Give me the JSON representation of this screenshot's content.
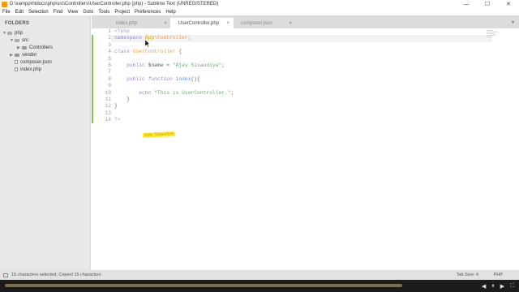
{
  "window": {
    "title": "D:\\xampp\\htdocs\\php\\src\\Controllers\\UserController.php (php) - Sublime Text (UNREGISTERED)",
    "controls": [
      "—",
      "☐",
      "✕"
    ]
  },
  "menu": [
    "File",
    "Edit",
    "Selection",
    "Find",
    "View",
    "Goto",
    "Tools",
    "Project",
    "Preferences",
    "Help"
  ],
  "sidebar": {
    "title": "FOLDERS",
    "items": [
      {
        "label": "php",
        "kind": "folder-open"
      },
      {
        "label": "src",
        "kind": "folder-open"
      },
      {
        "label": "Controllers",
        "kind": "folder-closed"
      },
      {
        "label": "vendor",
        "kind": "folder-closed"
      },
      {
        "label": "composer.json",
        "kind": "file"
      },
      {
        "label": "index.php",
        "kind": "file"
      }
    ]
  },
  "tabs": [
    {
      "label": "index.php",
      "active": false
    },
    {
      "label": "UserController.php",
      "active": true
    },
    {
      "label": "composer.json",
      "active": false
    }
  ],
  "tab_close_glyph": "×",
  "tab_dropdown_glyph": "▾",
  "code": {
    "line_numbers": [
      "1",
      "2",
      "3",
      "4",
      "5",
      "6",
      "7",
      "8",
      "9",
      "10",
      "11",
      "12",
      "13",
      "14"
    ],
    "lines": [
      "<?php",
      "namespace App\\Controller;",
      "",
      "class UserController {",
      "",
      "    public $name = \"Ajay Sisaudiya\";",
      "",
      "    public function index(){",
      "",
      "        echo \"This is UserController.\";",
      "    }",
      "}",
      "",
      "?>"
    ],
    "l1_tag": "<?php",
    "l2_kw": "namespace ",
    "l2_sel": "App",
    "l2_rest": "\\Controller;",
    "l4_kw": "class ",
    "l4_name": "UserController",
    "l4_brace": " {",
    "l6_indent": "    ",
    "l6_kw": "public ",
    "l6_var": "$name",
    "l6_eq": " = ",
    "l6_str": "\"Ajay Sisaudiya\"",
    "l6_semi": ";",
    "l8_kw1": "public ",
    "l8_kw2": "function ",
    "l8_fn": "index",
    "l8_rest": "(){",
    "l10_indent": "        ",
    "l10_kw": "echo ",
    "l10_str": "\"This is UserController.\"",
    "l10_semi": ";",
    "l11": "    }",
    "l12": "}",
    "l14_tag": "?>"
  },
  "watermark": "Ajay Sisaudiya",
  "status": {
    "message": "15 characters selected; Copied 15 characters",
    "tab_size": "Tab Size: 4",
    "syntax": "PHP"
  },
  "footer_controls": [
    "◀",
    "⏸",
    "▶",
    "⛶"
  ],
  "colors": {
    "sidebar_bg": "#e8e8e8",
    "editor_bg": "#ffffff",
    "modified_marker": "#8bc34a",
    "selection": "#fff2a8",
    "string": "#6fa870",
    "keyword": "#9e86c8"
  }
}
